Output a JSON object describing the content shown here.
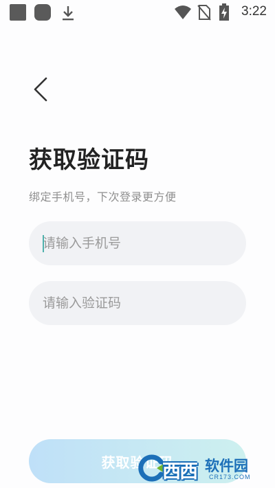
{
  "status_bar": {
    "time": "3:22",
    "left_icons": [
      "app-square-icon",
      "app-rounded-square-icon",
      "download-icon"
    ],
    "right_icons": [
      "wifi-icon",
      "no-sim-icon",
      "battery-charging-icon"
    ]
  },
  "header": {
    "back_icon": "chevron-left-icon"
  },
  "page": {
    "title": "获取验证码",
    "subtitle": "绑定手机号，下次登录更方便"
  },
  "form": {
    "phone": {
      "placeholder": "请输入手机号",
      "value": ""
    },
    "code": {
      "placeholder": "请输入验证码",
      "value": ""
    },
    "submit_label": "获取验证码"
  },
  "watermark": {
    "logo_text": "西西",
    "brand": "软件园",
    "url": "CR173.COM"
  },
  "colors": {
    "background": "#fdfdfe",
    "input_bg": "#f1f2f5",
    "caret": "#4fb1ac",
    "button_gradient_start": "#bfe0f8",
    "button_gradient_end": "#cdf0ef",
    "watermark_blue": "#1c6fb8"
  }
}
